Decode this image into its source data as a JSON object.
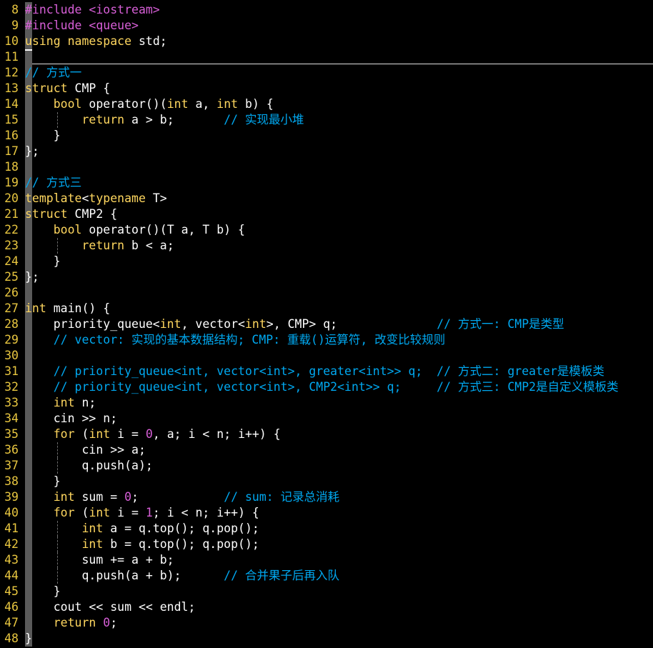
{
  "editor": {
    "lines": [
      {
        "n": "8",
        "segs": [
          [
            "p",
            "#include <iostream>"
          ]
        ]
      },
      {
        "n": "9",
        "segs": [
          [
            "p",
            "#include <queue>"
          ]
        ]
      },
      {
        "n": "10",
        "segs": [
          [
            "k",
            "using"
          ],
          [
            "t",
            " "
          ],
          [
            "k",
            "namespace"
          ],
          [
            "t",
            " std;"
          ]
        ]
      },
      {
        "n": "11",
        "segs": [],
        "cursor": true
      },
      {
        "n": "12",
        "segs": [
          [
            "c",
            "// 方式一"
          ]
        ]
      },
      {
        "n": "13",
        "segs": [
          [
            "k",
            "struct"
          ],
          [
            "t",
            " CMP {"
          ]
        ]
      },
      {
        "n": "14",
        "segs": [
          [
            "t",
            "    "
          ],
          [
            "k",
            "bool"
          ],
          [
            "t",
            " operator()("
          ],
          [
            "k",
            "int"
          ],
          [
            "t",
            " a, "
          ],
          [
            "k",
            "int"
          ],
          [
            "t",
            " b) {"
          ]
        ]
      },
      {
        "n": "15",
        "segs": [
          [
            "t",
            "        "
          ],
          [
            "k",
            "return"
          ],
          [
            "t",
            " a > b;       "
          ],
          [
            "c",
            "// 实现最小堆"
          ]
        ]
      },
      {
        "n": "16",
        "segs": [
          [
            "t",
            "    }"
          ]
        ]
      },
      {
        "n": "17",
        "segs": [
          [
            "t",
            "};"
          ]
        ]
      },
      {
        "n": "18",
        "segs": []
      },
      {
        "n": "19",
        "segs": [
          [
            "c",
            "// 方式三"
          ]
        ]
      },
      {
        "n": "20",
        "segs": [
          [
            "k",
            "template"
          ],
          [
            "t",
            "<"
          ],
          [
            "k",
            "typename"
          ],
          [
            "t",
            " T>"
          ]
        ]
      },
      {
        "n": "21",
        "segs": [
          [
            "k",
            "struct"
          ],
          [
            "t",
            " CMP2 {"
          ]
        ]
      },
      {
        "n": "22",
        "segs": [
          [
            "t",
            "    "
          ],
          [
            "k",
            "bool"
          ],
          [
            "t",
            " operator()(T a, T b) {"
          ]
        ]
      },
      {
        "n": "23",
        "segs": [
          [
            "t",
            "        "
          ],
          [
            "k",
            "return"
          ],
          [
            "t",
            " b < a;"
          ]
        ]
      },
      {
        "n": "24",
        "segs": [
          [
            "t",
            "    }"
          ]
        ]
      },
      {
        "n": "25",
        "segs": [
          [
            "t",
            "};"
          ]
        ]
      },
      {
        "n": "26",
        "segs": []
      },
      {
        "n": "27",
        "segs": [
          [
            "k",
            "int"
          ],
          [
            "t",
            " main() {"
          ]
        ]
      },
      {
        "n": "28",
        "segs": [
          [
            "t",
            "    priority_queue<"
          ],
          [
            "k",
            "int"
          ],
          [
            "t",
            ", vector<"
          ],
          [
            "k",
            "int"
          ],
          [
            "t",
            ">, CMP> q;              "
          ],
          [
            "c",
            "// 方式一: CMP是类型"
          ]
        ]
      },
      {
        "n": "29",
        "segs": [
          [
            "t",
            "    "
          ],
          [
            "c",
            "// vector: 实现的基本数据结构; CMP: 重载()运算符, 改变比较规则"
          ]
        ]
      },
      {
        "n": "30",
        "segs": []
      },
      {
        "n": "31",
        "segs": [
          [
            "t",
            "    "
          ],
          [
            "c",
            "// priority_queue<int, vector<int>, greater<int>> q;  // 方式二: greater是模板类"
          ]
        ]
      },
      {
        "n": "32",
        "segs": [
          [
            "t",
            "    "
          ],
          [
            "c",
            "// priority_queue<int, vector<int>, CMP2<int>> q;     // 方式三: CMP2是自定义模板类"
          ]
        ]
      },
      {
        "n": "33",
        "segs": [
          [
            "t",
            "    "
          ],
          [
            "k",
            "int"
          ],
          [
            "t",
            " n;"
          ]
        ]
      },
      {
        "n": "34",
        "segs": [
          [
            "t",
            "    cin >> n;"
          ]
        ]
      },
      {
        "n": "35",
        "segs": [
          [
            "t",
            "    "
          ],
          [
            "k",
            "for"
          ],
          [
            "t",
            " ("
          ],
          [
            "k",
            "int"
          ],
          [
            "t",
            " i = "
          ],
          [
            "p",
            "0"
          ],
          [
            "t",
            ", a; i < n; i++) {"
          ]
        ]
      },
      {
        "n": "36",
        "segs": [
          [
            "t",
            "        cin >> a;"
          ]
        ]
      },
      {
        "n": "37",
        "segs": [
          [
            "t",
            "        q.push(a);"
          ]
        ]
      },
      {
        "n": "38",
        "segs": [
          [
            "t",
            "    }"
          ]
        ]
      },
      {
        "n": "39",
        "segs": [
          [
            "t",
            "    "
          ],
          [
            "k",
            "int"
          ],
          [
            "t",
            " sum = "
          ],
          [
            "p",
            "0"
          ],
          [
            "t",
            ";            "
          ],
          [
            "c",
            "// sum: 记录总消耗"
          ]
        ]
      },
      {
        "n": "40",
        "segs": [
          [
            "t",
            "    "
          ],
          [
            "k",
            "for"
          ],
          [
            "t",
            " ("
          ],
          [
            "k",
            "int"
          ],
          [
            "t",
            " i = "
          ],
          [
            "p",
            "1"
          ],
          [
            "t",
            "; i < n; i++) {"
          ]
        ]
      },
      {
        "n": "41",
        "segs": [
          [
            "t",
            "        "
          ],
          [
            "k",
            "int"
          ],
          [
            "t",
            " a = q.top(); q.pop();"
          ]
        ]
      },
      {
        "n": "42",
        "segs": [
          [
            "t",
            "        "
          ],
          [
            "k",
            "int"
          ],
          [
            "t",
            " b = q.top(); q.pop();"
          ]
        ]
      },
      {
        "n": "43",
        "segs": [
          [
            "t",
            "        sum += a + b;"
          ]
        ]
      },
      {
        "n": "44",
        "segs": [
          [
            "t",
            "        q.push(a + b);      "
          ],
          [
            "c",
            "// 合并果子后再入队"
          ]
        ]
      },
      {
        "n": "45",
        "segs": [
          [
            "t",
            "    }"
          ]
        ]
      },
      {
        "n": "46",
        "segs": [
          [
            "t",
            "    cout << sum << endl;"
          ]
        ]
      },
      {
        "n": "47",
        "segs": [
          [
            "t",
            "    "
          ],
          [
            "k",
            "return"
          ],
          [
            "t",
            " "
          ],
          [
            "p",
            "0"
          ],
          [
            "t",
            ";"
          ]
        ]
      },
      {
        "n": "48",
        "segs": [
          [
            "t",
            "}"
          ]
        ]
      }
    ],
    "colors": {
      "background": "#000000",
      "line_number": "#e8c640",
      "keyword": "#ffd75f",
      "constant": "#d75fd7",
      "comment": "#00a8f0",
      "text": "#ffffff"
    }
  }
}
